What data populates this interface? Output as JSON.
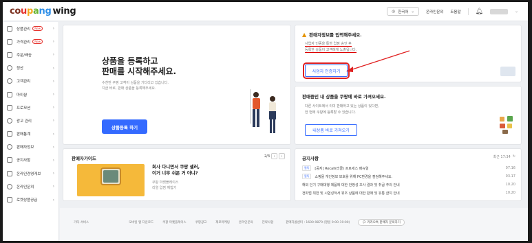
{
  "header": {
    "logo_parts": [
      "c",
      "o",
      "u",
      "p",
      "a",
      "n",
      "g"
    ],
    "logo_suffix": "wing",
    "language": "한국어",
    "links": [
      "온라인문의",
      "도움말"
    ],
    "user_name": ""
  },
  "sidebar": {
    "items": [
      {
        "label": "상품관리",
        "badge": "New"
      },
      {
        "label": "가격관리",
        "badge": "New"
      },
      {
        "label": "주문/배송",
        "badge": ""
      },
      {
        "label": "정산",
        "badge": ""
      },
      {
        "label": "고객관리",
        "badge": ""
      },
      {
        "label": "마이샵",
        "badge": ""
      },
      {
        "label": "프로모션",
        "badge": ""
      },
      {
        "label": "광고 관리",
        "badge": ""
      },
      {
        "label": "판매통계",
        "badge": ""
      },
      {
        "label": "판매자정보",
        "badge": ""
      },
      {
        "label": "공지사항",
        "badge": ""
      },
      {
        "label": "온라인경영게보",
        "badge": ""
      },
      {
        "label": "온라인문의",
        "badge": ""
      },
      {
        "label": "로켓상품공급",
        "badge": ""
      }
    ]
  },
  "hero": {
    "title_line1": "상품을 등록하고",
    "title_line2": "판매를 시작해주세요.",
    "sub_line1": "수천만 쿠팡 고객이 상품을 기다리고 있습니다.",
    "sub_line2": "지금 바로, 판매 상품을 등록해주세요.",
    "button": "상품등록 하기"
  },
  "registration": {
    "title": "판매자정보를 입력해주세요.",
    "desc_line1": "사업자 인증을 통한 입점 승인 후",
    "desc_line2": "등록한 상품이 고객에게 노출됩니다.",
    "button": "사업자 인증하기"
  },
  "import": {
    "title": "판매중인 내 상품을 쿠팡에 바로 가져오세요.",
    "desc_line1": "다른 사이트에서 이미 판매하고 있는 상품이 있다면,",
    "desc_line2": "한 번에 쿠팡에 등록할 수 있습니다.",
    "button": "내상품 바로 가져오기"
  },
  "guide": {
    "title": "판매자가이드",
    "page": "2/3",
    "headline_line1": "회사 다니면서 쿠팡 셀러,",
    "headline_line2": "이거 너무 쉬운 거 아냐?",
    "sub_line1": "쿠팡 마켓플레이스",
    "sub_line2": "리얼 입점 체험기"
  },
  "notice": {
    "title": "공지사항",
    "time_label": "최근 17:34",
    "rows": [
      {
        "tag": "필독",
        "text": "[공지] Recall(리콜) 프로세스 매뉴얼",
        "date": "07.16"
      },
      {
        "tag": "필독",
        "text": "쇼핑몰 개인정보 보호를 위해 PC환경을 점검해주세요.",
        "date": "03.17"
      },
      {
        "tag": "",
        "text": "해외 인기 구매대행 제품에 대한 안정성 조사 결과 및 취급 주의 안내",
        "date": "10.20"
      },
      {
        "tag": "",
        "text": "전파법 위반 및 시험성적서 위조 상품에 대한 판매 및 유통 금지 안내",
        "date": "10.20"
      }
    ]
  },
  "footer": {
    "label": "기타 서비스",
    "links": [
      "모바일 앱 다운로드",
      "쿠팡 마켓플레이스",
      "쿠팡광고",
      "제로마케팅",
      "온라인문의",
      "전략사항"
    ],
    "contact": "판매자콜센터 : 1600-9879 (평일 9:00-19:00)",
    "chat": "카카오톡 판매자 문의하기"
  },
  "colors": {
    "primary": "#346aff",
    "highlight": "#e02020"
  }
}
